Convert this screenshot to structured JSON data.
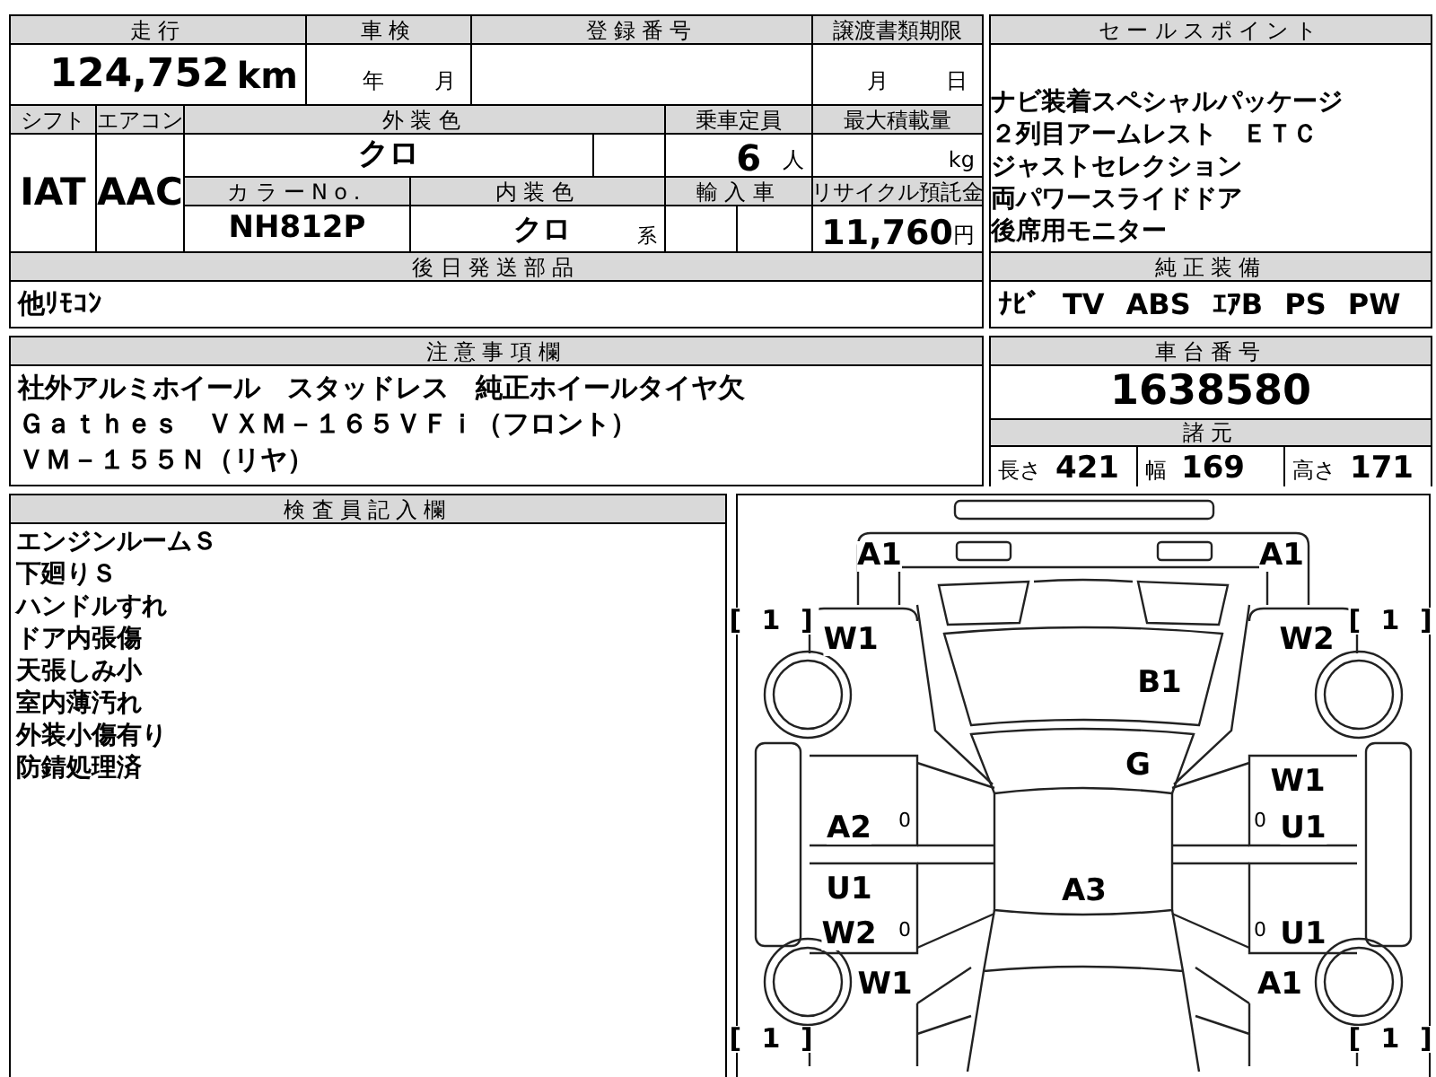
{
  "mileage": {
    "label": "走行",
    "value": "124,752",
    "unit": "km"
  },
  "inspection": {
    "label": "車検",
    "year_unit": "年",
    "month_unit": "月"
  },
  "registration": {
    "label": "登録番号"
  },
  "transfer_deadline": {
    "label": "譲渡書類期限",
    "month_unit": "月",
    "day_unit": "日"
  },
  "shift": {
    "label": "シフト",
    "value": "IAT"
  },
  "aircon": {
    "label": "エアコン",
    "value": "AAC"
  },
  "exterior_color": {
    "label": "外装色",
    "value": "クロ"
  },
  "capacity": {
    "label": "乗車定員",
    "value": "6",
    "unit": "人"
  },
  "max_load": {
    "label": "最大積載量",
    "unit": "kg"
  },
  "color_no": {
    "label": "カラーNo.",
    "value": "NH812P"
  },
  "interior_color": {
    "label": "内装色",
    "value": "クロ",
    "suffix": "系"
  },
  "import_car": {
    "label": "輸入車"
  },
  "recycle_fee": {
    "label": "リサイクル預託金",
    "value": "11,760",
    "unit": "円"
  },
  "parts_sent_later": {
    "label": "後日発送部品",
    "value": "他ﾘﾓｺﾝ"
  },
  "sale_points": {
    "label": "セールスポイント",
    "lines": [
      "ナビ装着スペシャルパッケージ",
      "２列目アームレスト　ＥＴＣ",
      "ジャストセレクション",
      "両パワースライドドア",
      "後席用モニター"
    ]
  },
  "standard_equipment": {
    "label": "純正装備",
    "items": [
      "ﾅﾋﾞ",
      "TV",
      "ABS",
      "ｴｱB",
      "PS",
      "PW"
    ]
  },
  "notes": {
    "label": "注意事項欄",
    "lines": [
      "社外アルミホイール　スタッドレス　純正ホイールタイヤ欠",
      "Ｇａｔｈｅｓ　ＶＸＭ－１６５ＶＦｉ（フロント）",
      "ＶＭ－１５５Ｎ（リヤ）"
    ]
  },
  "chassis_number": {
    "label": "車台番号",
    "value": "1638580"
  },
  "specs": {
    "label": "諸元",
    "items": [
      {
        "label": "長さ",
        "value": "421"
      },
      {
        "label": "幅",
        "value": "169"
      },
      {
        "label": "高さ",
        "value": "171"
      }
    ]
  },
  "inspector_notes": {
    "label": "検査員記入欄",
    "lines": [
      "エンジンルームＳ",
      "下廻りＳ",
      "ハンドルすれ",
      "ドア内張傷",
      "天張しみ小",
      "室内薄汚れ",
      "外装小傷有り",
      "防錆処理済"
    ]
  },
  "damage_diagram": {
    "marks": [
      {
        "kind": "code",
        "text": "A1"
      },
      {
        "kind": "code",
        "text": "A1"
      },
      {
        "kind": "tire",
        "text": "[ 1 ]"
      },
      {
        "kind": "code",
        "text": "W1"
      },
      {
        "kind": "tire",
        "text": "[ 1 ]"
      },
      {
        "kind": "code",
        "text": "W2"
      },
      {
        "kind": "code",
        "text": "B1"
      },
      {
        "kind": "code",
        "text": "G"
      },
      {
        "kind": "code",
        "text": "W1"
      },
      {
        "kind": "code",
        "text": "A2"
      },
      {
        "kind": "tread",
        "text": "0"
      },
      {
        "kind": "tread",
        "text": "0"
      },
      {
        "kind": "code",
        "text": "U1"
      },
      {
        "kind": "code",
        "text": "U1"
      },
      {
        "kind": "code",
        "text": "A3"
      },
      {
        "kind": "code",
        "text": "W2"
      },
      {
        "kind": "tread",
        "text": "0"
      },
      {
        "kind": "tread",
        "text": "0"
      },
      {
        "kind": "code",
        "text": "U1"
      },
      {
        "kind": "code",
        "text": "W1"
      },
      {
        "kind": "code",
        "text": "A1"
      },
      {
        "kind": "tire",
        "text": "[ 1 ]"
      },
      {
        "kind": "tire",
        "text": "[ 1 ]"
      }
    ]
  }
}
